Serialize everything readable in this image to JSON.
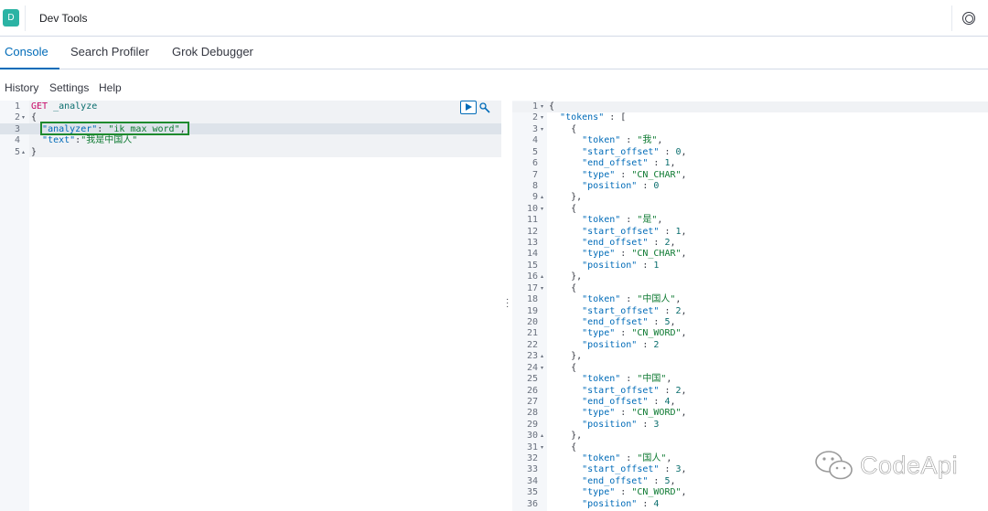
{
  "header": {
    "app_badge": "D",
    "title": "Dev Tools"
  },
  "tabs": [
    {
      "label": "Console",
      "active": true
    },
    {
      "label": "Search Profiler",
      "active": false
    },
    {
      "label": "Grok Debugger",
      "active": false
    }
  ],
  "menu": {
    "history": "History",
    "settings": "Settings",
    "help": "Help"
  },
  "request_editor": {
    "lines": [
      {
        "n": "1",
        "fold": "",
        "text": "GET _analyze"
      },
      {
        "n": "2",
        "fold": "▾",
        "text": "{"
      },
      {
        "n": "3",
        "fold": "",
        "text": "  \"analyzer\": \"ik_max_word\","
      },
      {
        "n": "4",
        "fold": "",
        "text": "  \"text\":\"我是中国人\""
      },
      {
        "n": "5",
        "fold": "▴",
        "text": "}"
      }
    ]
  },
  "response_editor": {
    "lines": [
      {
        "n": "1",
        "fold": "▾",
        "text": "{"
      },
      {
        "n": "2",
        "fold": "▾",
        "text": "  \"tokens\" : ["
      },
      {
        "n": "3",
        "fold": "▾",
        "text": "    {"
      },
      {
        "n": "4",
        "fold": "",
        "text": "      \"token\" : \"我\","
      },
      {
        "n": "5",
        "fold": "",
        "text": "      \"start_offset\" : 0,"
      },
      {
        "n": "6",
        "fold": "",
        "text": "      \"end_offset\" : 1,"
      },
      {
        "n": "7",
        "fold": "",
        "text": "      \"type\" : \"CN_CHAR\","
      },
      {
        "n": "8",
        "fold": "",
        "text": "      \"position\" : 0"
      },
      {
        "n": "9",
        "fold": "▴",
        "text": "    },"
      },
      {
        "n": "10",
        "fold": "▾",
        "text": "    {"
      },
      {
        "n": "11",
        "fold": "",
        "text": "      \"token\" : \"是\","
      },
      {
        "n": "12",
        "fold": "",
        "text": "      \"start_offset\" : 1,"
      },
      {
        "n": "13",
        "fold": "",
        "text": "      \"end_offset\" : 2,"
      },
      {
        "n": "14",
        "fold": "",
        "text": "      \"type\" : \"CN_CHAR\","
      },
      {
        "n": "15",
        "fold": "",
        "text": "      \"position\" : 1"
      },
      {
        "n": "16",
        "fold": "▴",
        "text": "    },"
      },
      {
        "n": "17",
        "fold": "▾",
        "text": "    {"
      },
      {
        "n": "18",
        "fold": "",
        "text": "      \"token\" : \"中国人\","
      },
      {
        "n": "19",
        "fold": "",
        "text": "      \"start_offset\" : 2,"
      },
      {
        "n": "20",
        "fold": "",
        "text": "      \"end_offset\" : 5,"
      },
      {
        "n": "21",
        "fold": "",
        "text": "      \"type\" : \"CN_WORD\","
      },
      {
        "n": "22",
        "fold": "",
        "text": "      \"position\" : 2"
      },
      {
        "n": "23",
        "fold": "▴",
        "text": "    },"
      },
      {
        "n": "24",
        "fold": "▾",
        "text": "    {"
      },
      {
        "n": "25",
        "fold": "",
        "text": "      \"token\" : \"中国\","
      },
      {
        "n": "26",
        "fold": "",
        "text": "      \"start_offset\" : 2,"
      },
      {
        "n": "27",
        "fold": "",
        "text": "      \"end_offset\" : 4,"
      },
      {
        "n": "28",
        "fold": "",
        "text": "      \"type\" : \"CN_WORD\","
      },
      {
        "n": "29",
        "fold": "",
        "text": "      \"position\" : 3"
      },
      {
        "n": "30",
        "fold": "▴",
        "text": "    },"
      },
      {
        "n": "31",
        "fold": "▾",
        "text": "    {"
      },
      {
        "n": "32",
        "fold": "",
        "text": "      \"token\" : \"国人\","
      },
      {
        "n": "33",
        "fold": "",
        "text": "      \"start_offset\" : 3,"
      },
      {
        "n": "34",
        "fold": "",
        "text": "      \"end_offset\" : 5,"
      },
      {
        "n": "35",
        "fold": "",
        "text": "      \"type\" : \"CN_WORD\","
      },
      {
        "n": "36",
        "fold": "",
        "text": "      \"position\" : 4"
      }
    ]
  },
  "watermark": {
    "text": "CodeApi"
  },
  "colors": {
    "accent": "#006bb8",
    "badge": "#2bb3a4",
    "highlight_box": "#1e8a2e"
  }
}
